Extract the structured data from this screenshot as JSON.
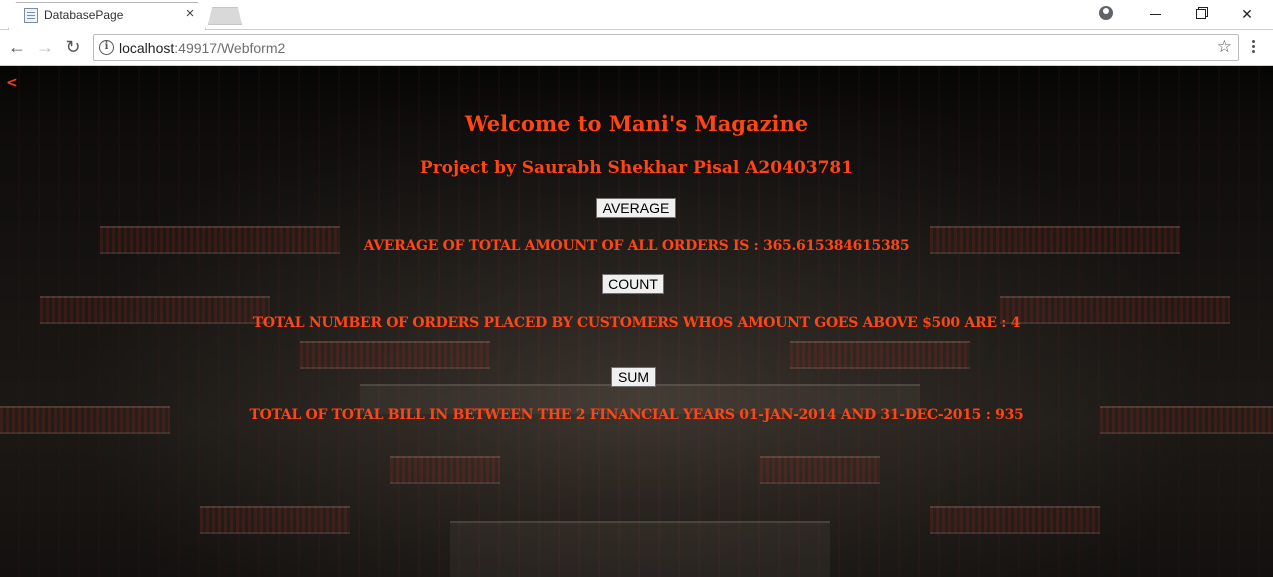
{
  "browser": {
    "tab_title": "DatabasePage",
    "tab_close": "×",
    "url_host": "localhost",
    "url_rest": ":49917/Webform2"
  },
  "page": {
    "back_link": "<",
    "title": "Welcome to Mani's Magazine",
    "subtitle": "Project by Saurabh Shekhar Pisal A20403781",
    "average_button": "AVERAGE",
    "average_result": "AVERAGE OF TOTAL AMOUNT OF ALL ORDERS IS : 365.615384615385",
    "count_button": "COUNT",
    "count_result": "TOTAL NUMBER OF ORDERS PLACED BY CUSTOMERS WHOS AMOUNT GOES ABOVE $500 ARE : 4",
    "sum_button": "SUM",
    "sum_result": "TOTAL OF TOTAL BILL IN BETWEEN THE 2 FINANCIAL YEARS 01-JAN-2014 AND 31-DEC-2015 : 935"
  },
  "colors": {
    "heading": "#ff4515",
    "background": "#2f2a25"
  }
}
